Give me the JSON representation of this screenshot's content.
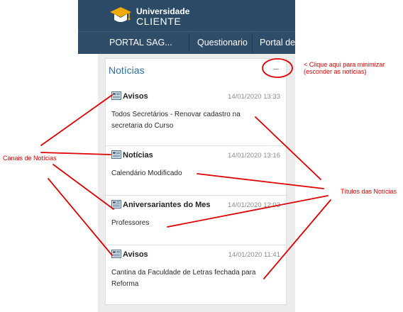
{
  "header": {
    "logo_top": "Universidade",
    "logo_bottom": "CLIENTE",
    "logo_icon": "graduation-cap-icon"
  },
  "nav": {
    "items": [
      "PORTAL SAG...",
      "Questionario",
      "Portal de A"
    ]
  },
  "panel": {
    "title": "Notícias",
    "minimize_symbol": "–",
    "items": [
      {
        "channel": "Avisos",
        "date": "14/01/2020 13:33",
        "title": "Todos Secretários - Renovar cadastro na secretaria do Curso"
      },
      {
        "channel": "Notícias",
        "date": "14/01/2020 13:16",
        "title": "Calendário Modificado"
      },
      {
        "channel": "Aniversariantes do Mes",
        "date": "14/01/2020 12:03",
        "title": "Professores"
      },
      {
        "channel": "Avisos",
        "date": "14/01/2020 11:41",
        "title": "Cantina da Faculdade de Letras fechada para Reforma"
      }
    ]
  },
  "annotations": {
    "minimize_line1": "< Clique aqui para minimizar",
    "minimize_line2": "(esconder as notícias)",
    "channels_label": "Canais de Notícias",
    "titles_label": "Títulos das Notícias",
    "color": "#e00000"
  },
  "colors": {
    "header_bg": "#2b4a66",
    "nav_bg": "#2f4c69",
    "logo_cap": "#f2a900",
    "panel_title": "#2f6fa0"
  }
}
